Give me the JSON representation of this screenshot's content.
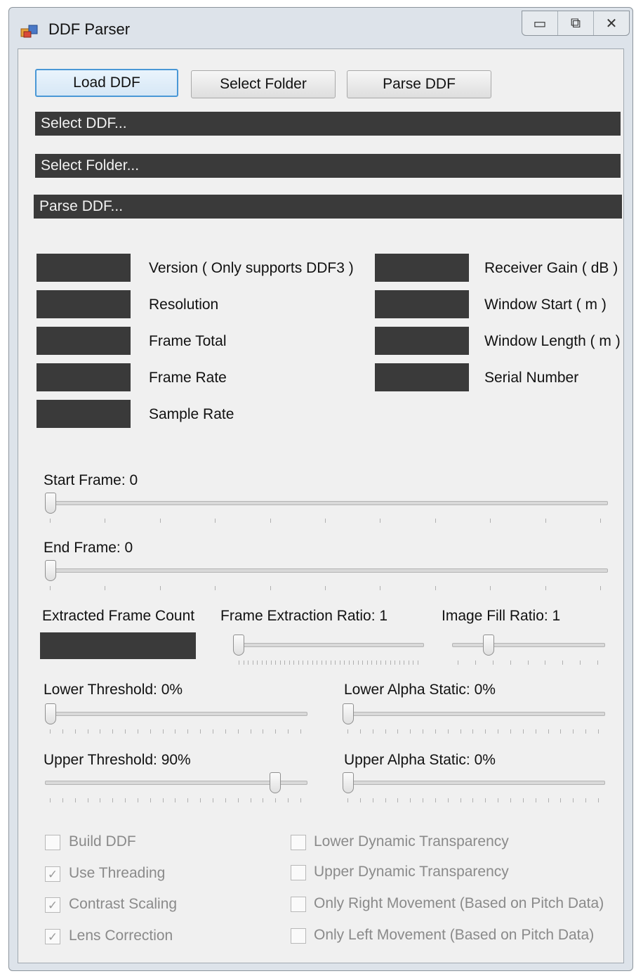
{
  "window": {
    "title": "DDF Parser",
    "app_icon": "app-icon",
    "controls": {
      "minimize": "▭",
      "maximize": "⧉",
      "close": "✕"
    }
  },
  "toolbar": {
    "load_label": "Load DDF",
    "select_folder_label": "Select Folder",
    "parse_label": "Parse DDF"
  },
  "status": {
    "select_ddf": "Select DDF...",
    "select_folder": "Select Folder...",
    "parse_ddf": "Parse DDF..."
  },
  "info_left": [
    "Version ( Only supports DDF3 )",
    "Resolution",
    "Frame Total",
    "Frame Rate",
    "Sample Rate"
  ],
  "info_right": [
    "Receiver Gain ( dB )",
    "Window Start ( m )",
    "Window Length ( m )",
    "Serial Number"
  ],
  "sliders": {
    "start_frame": {
      "label": "Start Frame: 0",
      "level": 0
    },
    "end_frame": {
      "label": "End Frame: 0",
      "level": 0
    },
    "extracted_frame_count_label": "Extracted Frame Count",
    "frame_extraction_ratio": {
      "label": "Frame Extraction Ratio: 1",
      "level": 0
    },
    "image_fill_ratio": {
      "label": "Image Fill Ratio: 1",
      "level": 0.22
    },
    "lower_threshold": {
      "label": "Lower Threshold: 0%",
      "level": 0
    },
    "lower_alpha_static": {
      "label": "Lower Alpha Static: 0%",
      "level": 0
    },
    "upper_threshold": {
      "label": "Upper Threshold: 90%",
      "level": 0.9
    },
    "upper_alpha_static": {
      "label": "Upper Alpha Static: 0%",
      "level": 0
    }
  },
  "options_left": [
    {
      "label": "Build DDF",
      "checked": false
    },
    {
      "label": "Use Threading",
      "checked": true
    },
    {
      "label": "Contrast Scaling",
      "checked": true
    },
    {
      "label": "Lens Correction",
      "checked": true
    }
  ],
  "options_right": [
    {
      "label": "Lower Dynamic Transparency",
      "checked": false
    },
    {
      "label": "Upper Dynamic Transparency",
      "checked": false
    },
    {
      "label": "Only Right Movement (Based on Pitch Data)",
      "checked": false
    },
    {
      "label": "Only Left Movement (Based on Pitch Data)",
      "checked": false
    }
  ],
  "colors": {
    "accent": "#4a98d6",
    "field_dark": "#3a3a3a",
    "disabled_text": "#8a8a8a"
  }
}
